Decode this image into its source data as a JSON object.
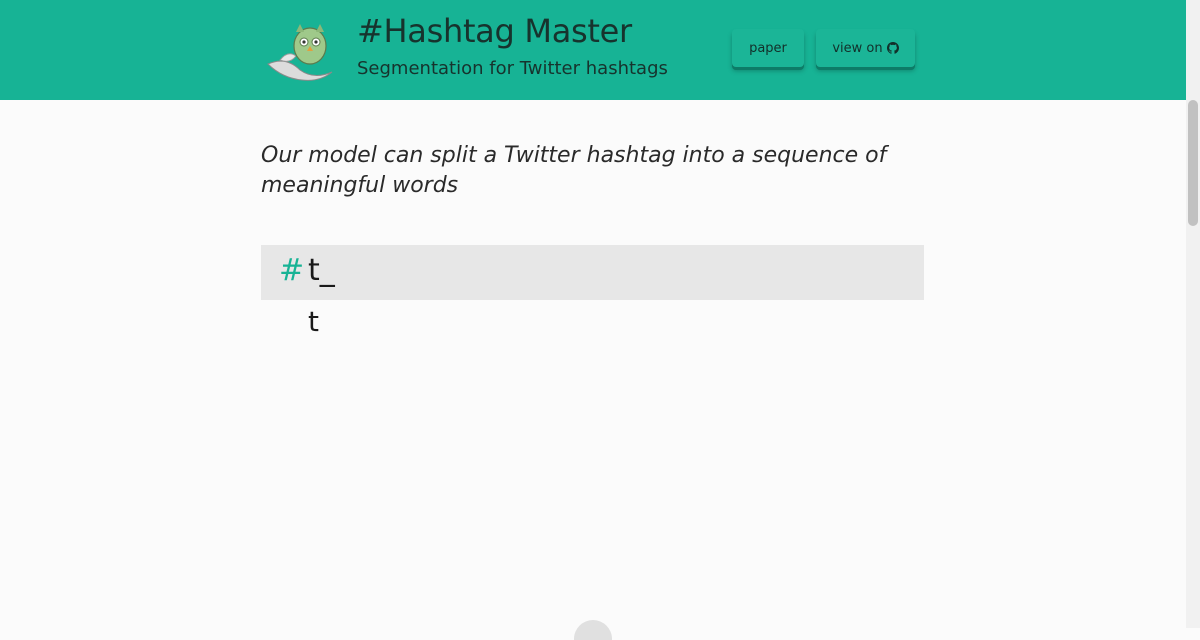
{
  "header": {
    "title": "#Hashtag Master",
    "subtitle": "Segmentation for Twitter hashtags",
    "buttons": {
      "paper": "paper",
      "view_on": "view on"
    },
    "accent_color": "#17b395"
  },
  "main": {
    "intro": "Our model can split a Twitter hashtag into a sequence of meaningful words",
    "input": {
      "hash_symbol": "#",
      "typed_text": "t_"
    },
    "segmentation_result": "t"
  },
  "icons": [
    "owl-mascot-logo",
    "github-icon"
  ]
}
